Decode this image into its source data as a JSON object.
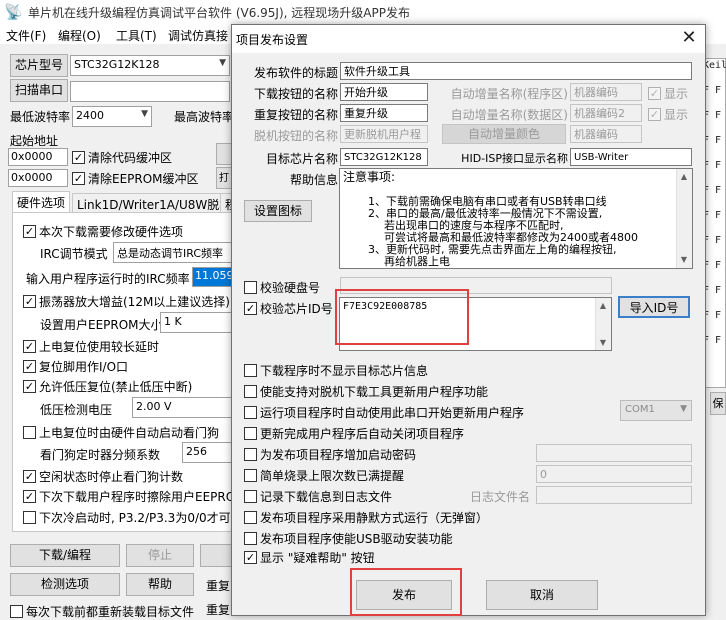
{
  "app": {
    "title": "单片机在线升级编程仿真调试平台软件 (V6.95J), 远程现场升级APP发布",
    "menu": [
      "文件(F)",
      "编程(O)",
      "工具(T)",
      "调试仿真接"
    ],
    "chip_label": "芯片型号",
    "chip_value": "STC32G12K128",
    "scan_button": "扫描串口",
    "min_baud_label": "最低波特率",
    "min_baud_value": "2400",
    "max_baud_label": "最高波特率",
    "start_addr_label": "起始地址",
    "start_addr_1": "0x0000",
    "clear_code_buffer": "清除代码缓冲区",
    "start_addr_2": "0x0000",
    "clear_eeprom_buffer": "清除EEPROM缓冲区",
    "tabs": [
      "硬件选项",
      "Link1D/Writer1A/U8W脱机",
      "程"
    ],
    "hw_options": {
      "set_hw_options": "本次下载需要修改硬件选项",
      "irc_mode_label": "IRC调节模式",
      "irc_mode_value": "总是动态调节IRC频率",
      "irc_freq_label": "输入用户程序运行时的IRC频率",
      "irc_freq_value": "11.0592",
      "osc_gain": "振荡器放大增益(12M以上建议选择)",
      "eeprom_size_label": "设置用户EEPROM大小",
      "eeprom_size_value": "1   K",
      "power_on_reset_delay": "上电复位使用较长延时",
      "reset_pin_io": "复位脚用作I/O口",
      "low_voltage_reset": "允许低压复位(禁止低压中断)",
      "low_voltage_label": "低压检测电压",
      "low_voltage_value": "2.00 V",
      "watchdog_on_power": "上电复位时由硬件自动启动看门狗",
      "watchdog_prescale_label": "看门狗定时器分频系数",
      "watchdog_prescale_value": "256",
      "idle_stop_watchdog": "空闲状态时停止看门狗计数",
      "next_download_eeprom": "下次下载用户程序时擦除用户EEPROM",
      "cold_start_p32": "下次冷启动时, P3.2/P3.3为0/0才可"
    },
    "download_button": "下载/编程",
    "stop_button": "停止",
    "detect_button": "检测选项",
    "help_button": "帮助",
    "repeat_label_1": "重复",
    "repeat_label_2": "重复",
    "reload_each_time": "每次下载前都重新装载目标文件",
    "right_code_lines": [
      "Keil",
      "F F",
      "F F",
      "F F",
      "F F",
      "F F",
      "F F",
      "F F",
      "F F",
      "F F",
      "F F",
      "F F"
    ],
    "right_button": "保"
  },
  "dialog": {
    "title": "项目发布设置",
    "release_title_label": "发布软件的标题",
    "release_title_value": "软件升级工具",
    "download_btn_name_label": "下载按钮的名称",
    "download_btn_name_value": "开始升级",
    "repeat_btn_name_label": "重复按钮的名称",
    "repeat_btn_name_value": "重复升级",
    "offline_btn_name_label": "脱机按钮的名称",
    "offline_btn_name_value": "更新脱机用户程",
    "auto_inc_prog_label": "自动增量名称(程序区)",
    "auto_inc_prog_value": "机器编码",
    "auto_inc_data_label": "自动增量名称(数据区)",
    "auto_inc_data_value": "机器编码2",
    "auto_inc_color_button": "自动增量颜色",
    "auto_inc_color_value": "机器编码",
    "show_label": "显示",
    "target_chip_label": "目标芯片名称",
    "target_chip_value": "STC32G12K128",
    "hid_isp_label": "HID-ISP接口显示名称",
    "hid_isp_value": "USB-Writer",
    "help_info_label": "帮助信息",
    "set_icon_button": "设置图标",
    "help_text_lines": [
      "注意事项:",
      "1、下载前需确保电脑有串口或者有USB转串口线",
      "2、串口的最高/最低波特率一般情况下不需设置,",
      "若出现串口的速度与本程序不匹配时,",
      "可尝试将最高和最低波特率都修改为2400或者4800",
      "3、更新代码时, 需要先点击界面左上角的编程按钮,",
      "再给机器上电"
    ],
    "verify_disk_label": "校验硬盘号",
    "verify_chip_id_label": "校验芯片ID号",
    "chip_id_value": "F7E3C92E008785",
    "import_id_button": "导入ID号",
    "options": [
      "下载程序时不显示目标芯片信息",
      "使能支持对脱机下载工具更新用户程序功能",
      "运行项目程序时自动使用此串口开始更新用户程序",
      "更新完成用户程序后自动关闭项目程序",
      "为发布项目程序增加启动密码",
      "简单烧录上限次数已满提醒",
      "记录下载信息到日志文件",
      "发布项目程序采用静默方式运行（无弹窗）",
      "发布项目程序使能USB驱动安装功能",
      "显示 \"疑难帮助\" 按钮"
    ],
    "com_port_value": "COM1",
    "burn_limit_value": "0",
    "log_file_label": "日志文件名",
    "publish_button": "发布",
    "cancel_button": "取消"
  },
  "colors": {
    "highlight": "#e04040",
    "window_bg": "#f0f0f0",
    "selected_input_bg": "#0078d7"
  }
}
